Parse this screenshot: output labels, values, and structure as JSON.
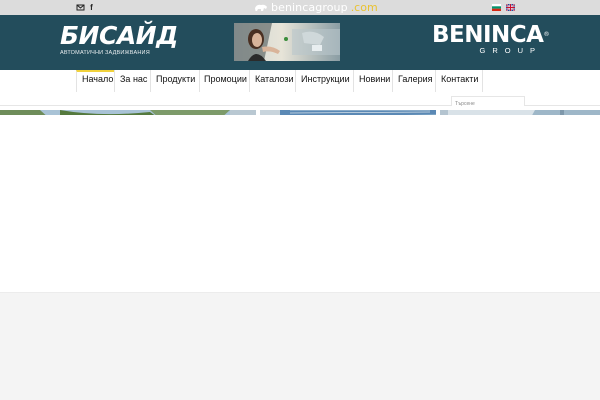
{
  "topbar": {
    "mail_icon": "mail-icon",
    "facebook_icon": "facebook-icon",
    "site_brand": "benincagroup",
    "site_tld": ".com",
    "lang_bg_flag": "bulgarian-flag-icon",
    "lang_en_flag": "uk-flag-icon"
  },
  "header": {
    "logo_title": "БИСАЙД",
    "logo_subtitle": "АВТОМАТИЧНИ ЗАДВИЖВАНИЯ",
    "right_logo_title": "BENINCA",
    "right_logo_reg": "®",
    "right_logo_sub": "GROUP"
  },
  "nav": {
    "items": [
      {
        "label": "Начало",
        "active": true
      },
      {
        "label": "За нас"
      },
      {
        "label": "Продукти"
      },
      {
        "label": "Промоции"
      },
      {
        "label": "Каталози"
      },
      {
        "label": "Инструкции"
      },
      {
        "label": "Новини"
      },
      {
        "label": "Галерия"
      },
      {
        "label": "Контакти"
      }
    ],
    "search_placeholder": "Търсене"
  },
  "colors": {
    "header_bg": "#234d5c",
    "accent": "#f1d23d",
    "topbar_bg": "#dcdcdc"
  }
}
